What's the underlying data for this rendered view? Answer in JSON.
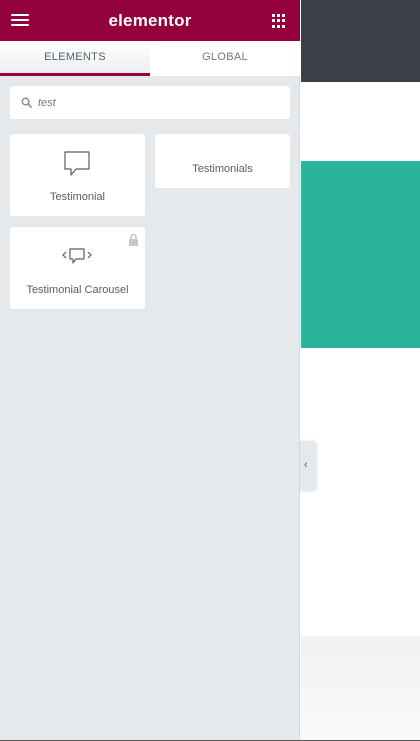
{
  "header": {
    "brand": "elementor",
    "menu_icon": "hamburger-icon",
    "apps_icon": "grid-icon",
    "color": "#93003c"
  },
  "tabs": [
    {
      "label": "ELEMENTS",
      "active": true
    },
    {
      "label": "GLOBAL",
      "active": false
    }
  ],
  "search": {
    "value": "",
    "placeholder": "test",
    "icon": "search-icon"
  },
  "widgets": [
    {
      "label": "Testimonial",
      "icon": "speech-bubble-icon",
      "locked": false
    },
    {
      "label": "Testimonials",
      "icon": "",
      "locked": false
    },
    {
      "label": "Testimonial Carousel",
      "icon": "carousel-bubble-icon",
      "locked": true
    }
  ],
  "canvas": {
    "topbar_color": "#3a3f4a",
    "section_color": "#2bb39b"
  },
  "panel_toggle": {
    "icon": "chevron-left-icon",
    "text": "‹"
  }
}
